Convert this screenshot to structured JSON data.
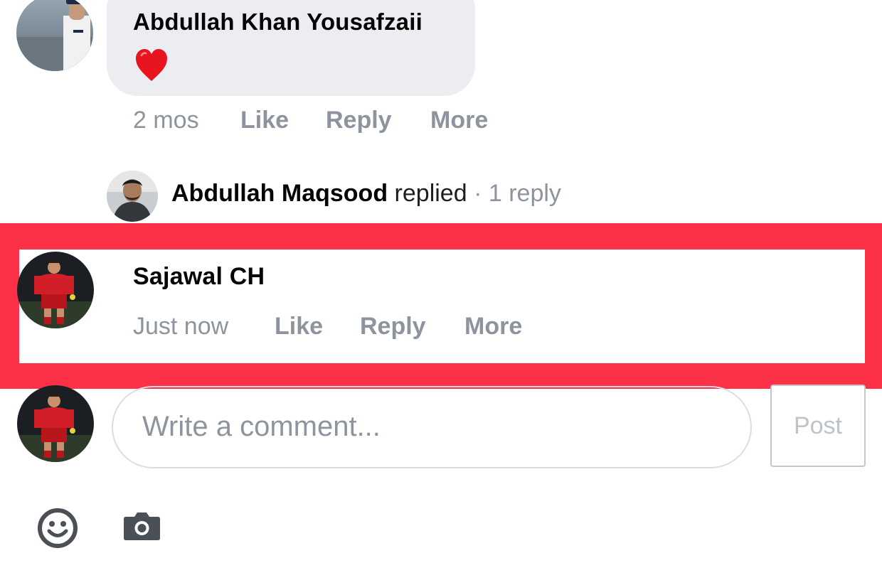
{
  "comments": [
    {
      "author": "Abdullah Khan Yousafzaii",
      "body_emoji": "heart-emoji",
      "time": "2 mos",
      "like_label": "Like",
      "reply_label": "Reply",
      "more_label": "More",
      "replies_summary": {
        "author": "Abdullah Maqsood",
        "verb": "replied",
        "separator": "·",
        "count_label": "1 reply"
      }
    },
    {
      "author": "Sajawal CH",
      "time": "Just now",
      "like_label": "Like",
      "reply_label": "Reply",
      "more_label": "More",
      "highlighted": true
    }
  ],
  "composer": {
    "placeholder": "Write a comment...",
    "post_label": "Post"
  },
  "toolbar": {
    "icons": [
      "smiley-icon",
      "camera-icon"
    ]
  },
  "colors": {
    "highlight": "#fc3147",
    "bubble": "#ebedf0",
    "muted_text": "#8d949e",
    "icon": "#4b4f56"
  }
}
